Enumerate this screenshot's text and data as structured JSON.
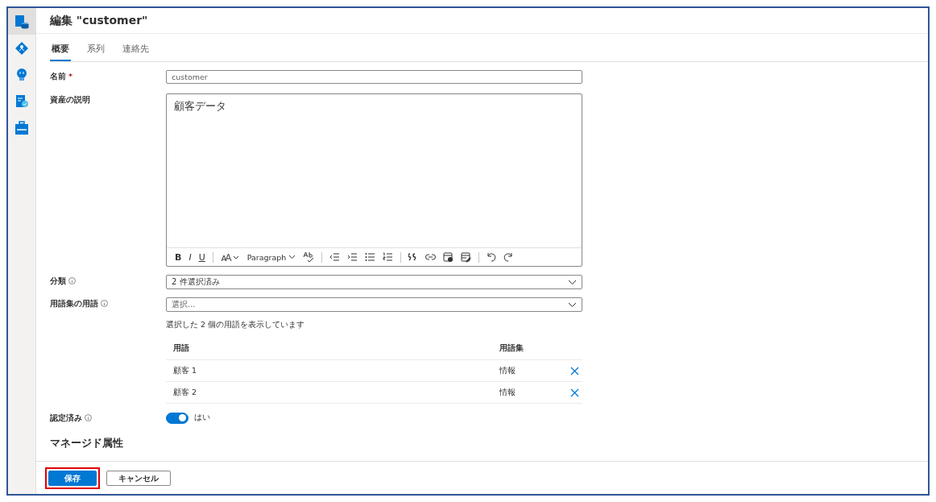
{
  "sidebar": {
    "items": [
      {
        "kind": "assets",
        "selected": true
      },
      {
        "kind": "diamond",
        "selected": false
      },
      {
        "kind": "bulb",
        "selected": false
      },
      {
        "kind": "certificate",
        "selected": false
      },
      {
        "kind": "toolbox",
        "selected": false
      }
    ]
  },
  "header": {
    "title": "編集 \"customer\""
  },
  "tabs": [
    {
      "label": "概要",
      "selected": true
    },
    {
      "label": "系列",
      "selected": false
    },
    {
      "label": "連絡先",
      "selected": false
    }
  ],
  "form": {
    "name": {
      "label": "名前",
      "required_mark": "*",
      "value": "customer"
    },
    "description": {
      "label": "資産の説明",
      "value": "顧客データ",
      "toolbar": [
        {
          "kind": "bold",
          "label": "B"
        },
        {
          "kind": "italic",
          "label": "I"
        },
        {
          "kind": "underline",
          "label": "U"
        },
        {
          "kind": "separator"
        },
        {
          "kind": "font-size"
        },
        {
          "kind": "dropdown",
          "label": "Paragraph"
        },
        {
          "kind": "spell"
        },
        {
          "kind": "separator"
        },
        {
          "kind": "outdent"
        },
        {
          "kind": "indent"
        },
        {
          "kind": "bullets"
        },
        {
          "kind": "numbering"
        },
        {
          "kind": "separator"
        },
        {
          "kind": "quote"
        },
        {
          "kind": "link"
        },
        {
          "kind": "image"
        },
        {
          "kind": "table"
        },
        {
          "kind": "separator"
        },
        {
          "kind": "undo"
        },
        {
          "kind": "redo"
        }
      ]
    },
    "classification": {
      "label": "分類",
      "value": "2 件選択済み"
    },
    "glossary": {
      "label": "用語集の用語",
      "placeholder": "選択...",
      "note": "選択した 2 個の用語を表示しています",
      "columns": [
        "用語",
        "用語集"
      ],
      "rows": [
        {
          "term": "顧客 1",
          "glossary": "情報"
        },
        {
          "term": "顧客 2",
          "glossary": "情報"
        }
      ]
    },
    "certified": {
      "label": "認定済み",
      "on": true,
      "text": "はい"
    },
    "managed_attributes": {
      "heading": "マネージド属性"
    }
  },
  "footer": {
    "buttons": [
      {
        "label": "保存",
        "kind": "primary",
        "highlighted": true
      },
      {
        "label": "キャンセル",
        "kind": "secondary",
        "highlighted": false
      }
    ]
  }
}
